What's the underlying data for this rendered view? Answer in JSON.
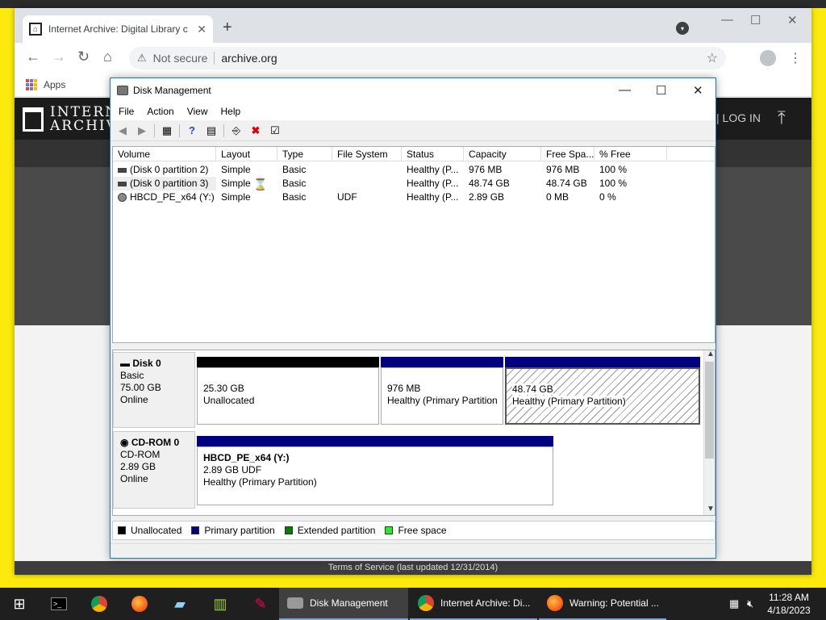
{
  "browser": {
    "tab_title": "Internet Archive: Digital Library c",
    "tab_close": "✕",
    "new_tab": "+",
    "security": "Not secure",
    "url": "archive.org",
    "bookmarks_apps": "Apps"
  },
  "site": {
    "logo_line1": "INTERN",
    "logo_line2": "ARCHIVI",
    "login": "| LOG IN",
    "footer": "Terms of Service (last updated 12/31/2014)"
  },
  "dm": {
    "title": "Disk Management",
    "menu": [
      "File",
      "Action",
      "View",
      "Help"
    ],
    "columns": [
      "Volume",
      "Layout",
      "Type",
      "File System",
      "Status",
      "Capacity",
      "Free Spa...",
      "% Free"
    ],
    "volumes": [
      {
        "volume": "(Disk 0 partition 2)",
        "layout": "Simple",
        "type": "Basic",
        "fs": "",
        "status": "Healthy (P...",
        "capacity": "976 MB",
        "free": "976 MB",
        "pct": "100 %"
      },
      {
        "volume": "(Disk 0 partition 3)",
        "layout": "Simple",
        "type": "Basic",
        "fs": "",
        "status": "Healthy (P...",
        "capacity": "48.74 GB",
        "free": "48.74 GB",
        "pct": "100 %"
      },
      {
        "volume": "HBCD_PE_x64 (Y:)",
        "layout": "Simple",
        "type": "Basic",
        "fs": "UDF",
        "status": "Healthy (P...",
        "capacity": "2.89 GB",
        "free": "0 MB",
        "pct": "0 %"
      }
    ],
    "disk0": {
      "name": "Disk 0",
      "kind": "Basic",
      "size": "75.00 GB",
      "state": "Online",
      "partitions": [
        {
          "line1": "25.30 GB",
          "line2": "Unallocated"
        },
        {
          "line1": "976 MB",
          "line2": "Healthy (Primary Partition"
        },
        {
          "line1": "48.74 GB",
          "line2": "Healthy (Primary Partition)"
        }
      ]
    },
    "cdrom0": {
      "name": "CD-ROM 0",
      "kind": "CD-ROM",
      "size": "2.89 GB",
      "state": "Online",
      "volume_name": "HBCD_PE_x64  (Y:)",
      "volume_fs": "2.89 GB UDF",
      "volume_status": "Healthy (Primary Partition)"
    },
    "legend": [
      "Unallocated",
      "Primary partition",
      "Extended partition",
      "Free space"
    ]
  },
  "colors": {
    "unallocated": "#000000",
    "primary": "#000080",
    "extended": "#008000",
    "free": "#22ee22",
    "accent": "#1979ca"
  },
  "taskbar": {
    "windows": [
      "Disk Management",
      "Internet Archive: Di...",
      "Warning: Potential ..."
    ],
    "time": "11:28 AM",
    "date": "4/18/2023"
  }
}
